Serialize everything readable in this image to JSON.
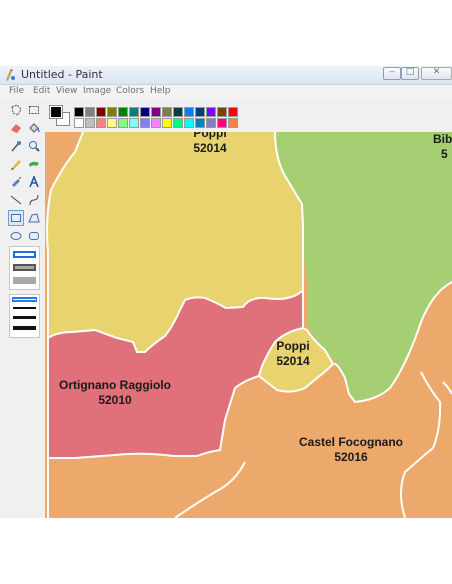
{
  "window": {
    "title": "Untitled - Paint",
    "controls": {
      "minimize": "‒",
      "maximize": "□",
      "close": "✕"
    }
  },
  "menu": [
    "File",
    "Edit",
    "View",
    "Image",
    "Colors",
    "Help"
  ],
  "tools": [
    "free-select",
    "select",
    "eraser",
    "fill",
    "color-picker",
    "magnifier",
    "pencil",
    "brush",
    "airbrush",
    "text",
    "line",
    "curve",
    "rectangle",
    "polygon",
    "ellipse",
    "rounded-rectangle"
  ],
  "selected_tool": "rectangle",
  "palette": {
    "foreground": "#000000",
    "background": "#ffffff",
    "row1": [
      "#000000",
      "#808080",
      "#800000",
      "#808000",
      "#008000",
      "#008080",
      "#000080",
      "#800080",
      "#808040",
      "#004040",
      "#0080ff",
      "#004080",
      "#8000ff",
      "#804000",
      "#ff0000"
    ],
    "row2": [
      "#ffffff",
      "#c0c0c0",
      "#ff8080",
      "#ffff80",
      "#80ff80",
      "#80ffff",
      "#8080ff",
      "#ff80ff",
      "#ffff00",
      "#00ff80",
      "#00ffff",
      "#0080c0",
      "#8080c0",
      "#ff0080",
      "#ff8040"
    ]
  },
  "map": {
    "regions": [
      {
        "name": "Poppi",
        "code": "52014",
        "color": "#e8d36f"
      },
      {
        "name": "Bib",
        "code": "5",
        "color": "#a6cf73"
      },
      {
        "name": "Poppi",
        "code": "52014",
        "color": "#e8d36f"
      },
      {
        "name": "Ortignano Raggiolo",
        "code": "52010",
        "color": "#e0707a"
      },
      {
        "name": "Castel Focognano",
        "code": "52016",
        "color": "#eda96b"
      }
    ],
    "background_region_color": "#eda96b"
  }
}
